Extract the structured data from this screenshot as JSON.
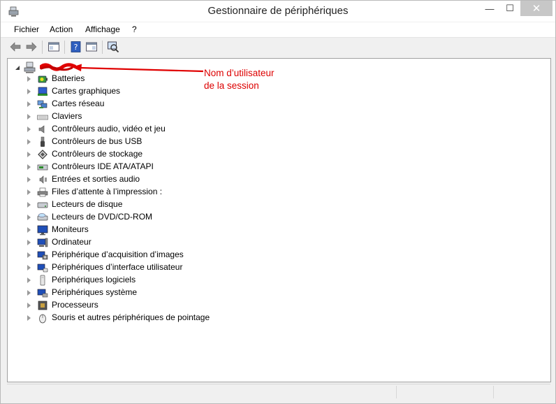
{
  "window": {
    "title": "Gestionnaire de périphériques",
    "controls": {
      "minimize": "—",
      "maximize": "☐",
      "close": "✕"
    }
  },
  "menu": [
    "Fichier",
    "Action",
    "Affichage",
    "?"
  ],
  "toolbar": {
    "icons": [
      "back-arrow-icon",
      "forward-arrow-icon",
      "properties-panel-icon",
      "help-icon",
      "show-hide-console-tree-icon",
      "scan-hardware-icon"
    ]
  },
  "tree": {
    "root": {
      "label_redacted": true,
      "icon": "computer-icon"
    },
    "items": [
      {
        "label": "Batteries",
        "icon": "battery-icon"
      },
      {
        "label": "Cartes graphiques",
        "icon": "display-adapter-icon"
      },
      {
        "label": "Cartes réseau",
        "icon": "network-adapter-icon"
      },
      {
        "label": "Claviers",
        "icon": "keyboard-icon"
      },
      {
        "label": "Contrôleurs audio, vidéo et jeu",
        "icon": "speaker-icon"
      },
      {
        "label": "Contrôleurs de bus USB",
        "icon": "usb-icon"
      },
      {
        "label": "Contrôleurs de stockage",
        "icon": "storage-controller-icon"
      },
      {
        "label": "Contrôleurs IDE ATA/ATAPI",
        "icon": "ide-controller-icon"
      },
      {
        "label": "Entrées et sorties audio",
        "icon": "audio-io-icon"
      },
      {
        "label": "Files d’attente à l’impression :",
        "icon": "printer-icon"
      },
      {
        "label": "Lecteurs de disque",
        "icon": "disk-drive-icon"
      },
      {
        "label": "Lecteurs de DVD/CD-ROM",
        "icon": "dvd-drive-icon"
      },
      {
        "label": "Moniteurs",
        "icon": "monitor-icon"
      },
      {
        "label": "Ordinateur",
        "icon": "computer-icon"
      },
      {
        "label": "Périphérique d’acquisition d’images",
        "icon": "camera-icon"
      },
      {
        "label": "Périphériques d’interface utilisateur",
        "icon": "hid-icon"
      },
      {
        "label": "Périphériques logiciels",
        "icon": "software-device-icon"
      },
      {
        "label": "Périphériques système",
        "icon": "system-device-icon"
      },
      {
        "label": "Processeurs",
        "icon": "processor-icon"
      },
      {
        "label": "Souris et autres périphériques de pointage",
        "icon": "mouse-icon"
      }
    ]
  },
  "annotation": {
    "text": "Nom d’utilisateur\nde la session",
    "color": "#dd0000"
  }
}
